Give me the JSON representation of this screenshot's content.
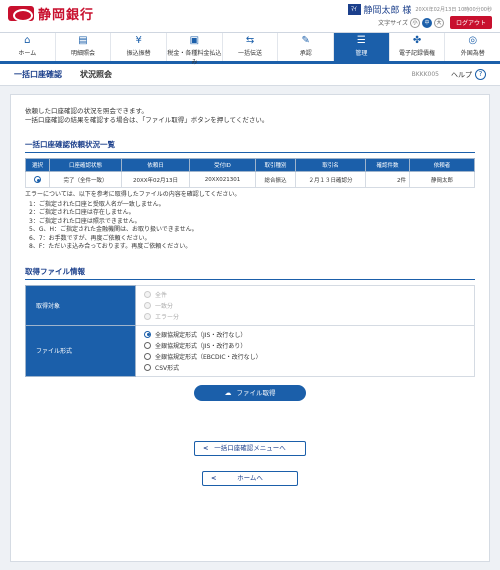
{
  "header": {
    "bank_name": "静岡銀行",
    "user_badge": "ﾏｲ",
    "user_name": "静岡太郎 様",
    "login_time": "20XX年02月13日 10時00分00秒",
    "text_size_label": "文字サイズ",
    "text_sizes": [
      "小",
      "中",
      "大"
    ],
    "logout": "ログアウト"
  },
  "nav": [
    {
      "label": "ホーム",
      "icon": "home-icon",
      "glyph": "⌂"
    },
    {
      "label": "明細照会",
      "icon": "document-icon",
      "glyph": "▤"
    },
    {
      "label": "振込振替",
      "icon": "yen-icon",
      "glyph": "¥"
    },
    {
      "label": "税金・各種料金払込み",
      "icon": "bill-icon",
      "glyph": "▣"
    },
    {
      "label": "一括伝送",
      "icon": "transfer-icon",
      "glyph": "⇆"
    },
    {
      "label": "承認",
      "icon": "approval-icon",
      "glyph": "✎"
    },
    {
      "label": "管理",
      "icon": "management-icon",
      "glyph": "☰"
    },
    {
      "label": "電子記録債権",
      "icon": "e-receivable-icon",
      "glyph": "✤"
    },
    {
      "label": "外国為替",
      "icon": "forex-icon",
      "glyph": "◎"
    }
  ],
  "title": {
    "main": "一括口座確認",
    "sub": "状況照会",
    "screen_id": "BKKK005",
    "help": "ヘルプ"
  },
  "intro": [
    "依頼した口座確認の状況を照会できます。",
    "一括口座確認の結果を確認する場合は、「ファイル取得」ボタンを押してください。"
  ],
  "status_section": {
    "title": "一括口座確認依頼状況一覧",
    "columns": [
      "選択",
      "口座確認状態",
      "依頼日",
      "受付ID",
      "取引種別",
      "取引名",
      "確認件数",
      "依頼者"
    ],
    "row": {
      "status": "完了（全件一致）",
      "date": "20XX年02月13日",
      "id": "20XX021301",
      "type": "総合振込",
      "name": "２月１３日確認分",
      "count": "2件",
      "requester": "静岡太郎"
    }
  },
  "notes": {
    "head": "エラーについては、以下を参考に取得したファイルの内容を確認してください。",
    "items": [
      "1：ご指定された口座と受取人名が一致しません。",
      "2：ご指定された口座は存在しません。",
      "3：ご指定された口座は照示できません。",
      "5、G、H：ご指定された金融機関は、お取り扱いできません。",
      "6、7：お手数ですが、再度ご依頼ください。",
      "8、F：ただいま込み合っております。再度ご依頼ください。"
    ]
  },
  "file_section": {
    "title": "取得ファイル情報",
    "target_label": "取得対象",
    "target_options": [
      "全件",
      "一致分",
      "エラー分"
    ],
    "format_label": "ファイル形式",
    "format_options": [
      "全銀協規定形式（JIS・改行なし）",
      "全銀協規定形式（JIS・改行あり）",
      "全銀協規定形式（EBCDIC・改行なし）",
      "CSV形式"
    ]
  },
  "buttons": {
    "file_get": "ファイル取得",
    "menu": "一括口座確認メニューへ",
    "home": "ホームへ"
  }
}
